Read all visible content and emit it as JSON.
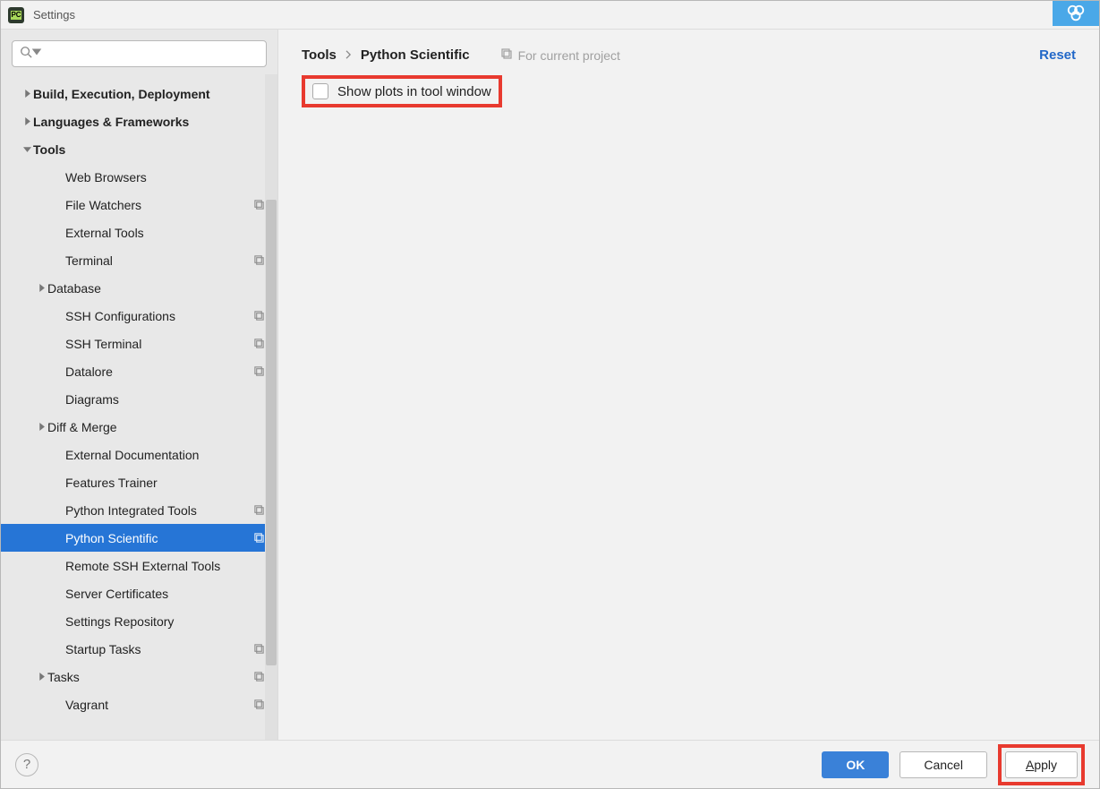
{
  "window": {
    "title": "Settings"
  },
  "search": {
    "placeholder": ""
  },
  "sidebar": {
    "items": [
      {
        "label": "Build, Execution, Deployment",
        "indent": 0,
        "bold": true,
        "chevron": "right",
        "copy": false,
        "selected": false
      },
      {
        "label": "Languages & Frameworks",
        "indent": 0,
        "bold": true,
        "chevron": "right",
        "copy": false,
        "selected": false
      },
      {
        "label": "Tools",
        "indent": 0,
        "bold": true,
        "chevron": "down",
        "copy": false,
        "selected": false
      },
      {
        "label": "Web Browsers",
        "indent": 2,
        "bold": false,
        "chevron": "",
        "copy": false,
        "selected": false
      },
      {
        "label": "File Watchers",
        "indent": 2,
        "bold": false,
        "chevron": "",
        "copy": true,
        "selected": false
      },
      {
        "label": "External Tools",
        "indent": 2,
        "bold": false,
        "chevron": "",
        "copy": false,
        "selected": false
      },
      {
        "label": "Terminal",
        "indent": 2,
        "bold": false,
        "chevron": "",
        "copy": true,
        "selected": false
      },
      {
        "label": "Database",
        "indent": 1,
        "bold": false,
        "chevron": "right",
        "copy": false,
        "selected": false
      },
      {
        "label": "SSH Configurations",
        "indent": 2,
        "bold": false,
        "chevron": "",
        "copy": true,
        "selected": false
      },
      {
        "label": "SSH Terminal",
        "indent": 2,
        "bold": false,
        "chevron": "",
        "copy": true,
        "selected": false
      },
      {
        "label": "Datalore",
        "indent": 2,
        "bold": false,
        "chevron": "",
        "copy": true,
        "selected": false
      },
      {
        "label": "Diagrams",
        "indent": 2,
        "bold": false,
        "chevron": "",
        "copy": false,
        "selected": false
      },
      {
        "label": "Diff & Merge",
        "indent": 1,
        "bold": false,
        "chevron": "right",
        "copy": false,
        "selected": false
      },
      {
        "label": "External Documentation",
        "indent": 2,
        "bold": false,
        "chevron": "",
        "copy": false,
        "selected": false
      },
      {
        "label": "Features Trainer",
        "indent": 2,
        "bold": false,
        "chevron": "",
        "copy": false,
        "selected": false
      },
      {
        "label": "Python Integrated Tools",
        "indent": 2,
        "bold": false,
        "chevron": "",
        "copy": true,
        "selected": false
      },
      {
        "label": "Python Scientific",
        "indent": 2,
        "bold": false,
        "chevron": "",
        "copy": true,
        "selected": true
      },
      {
        "label": "Remote SSH External Tools",
        "indent": 2,
        "bold": false,
        "chevron": "",
        "copy": false,
        "selected": false
      },
      {
        "label": "Server Certificates",
        "indent": 2,
        "bold": false,
        "chevron": "",
        "copy": false,
        "selected": false
      },
      {
        "label": "Settings Repository",
        "indent": 2,
        "bold": false,
        "chevron": "",
        "copy": false,
        "selected": false
      },
      {
        "label": "Startup Tasks",
        "indent": 2,
        "bold": false,
        "chevron": "",
        "copy": true,
        "selected": false
      },
      {
        "label": "Tasks",
        "indent": 1,
        "bold": false,
        "chevron": "right",
        "copy": true,
        "selected": false
      },
      {
        "label": "Vagrant",
        "indent": 2,
        "bold": false,
        "chevron": "",
        "copy": true,
        "selected": false
      }
    ]
  },
  "breadcrumb": {
    "root": "Tools",
    "leaf": "Python Scientific",
    "project_hint": "For current project"
  },
  "main": {
    "reset": "Reset",
    "option_show_plots": "Show plots in tool window",
    "show_plots_checked": false
  },
  "footer": {
    "help": "?",
    "ok": "OK",
    "cancel": "Cancel",
    "apply": "Apply"
  }
}
